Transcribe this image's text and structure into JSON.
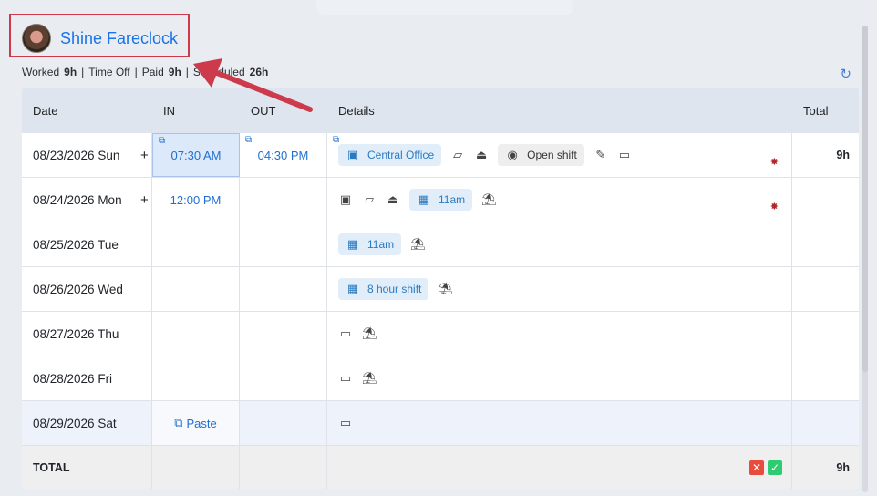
{
  "user": {
    "name": "Shine Fareclock"
  },
  "summary": {
    "worked_label": "Worked",
    "worked_value": "9h",
    "timeoff_label": "Time Off",
    "paid_label": "Paid",
    "paid_value": "9h",
    "scheduled_label": "Scheduled",
    "scheduled_value": "26h"
  },
  "columns": {
    "date": "Date",
    "in": "IN",
    "out": "OUT",
    "details": "Details",
    "total": "Total"
  },
  "rows": [
    {
      "date": "08/23/2026 Sun",
      "in": "07:30 AM",
      "out": "04:30 PM",
      "location": "Central Office",
      "open_shift": "Open shift",
      "total": "9h"
    },
    {
      "date": "08/24/2026 Mon",
      "in": "12:00 PM",
      "shift": "11am"
    },
    {
      "date": "08/25/2026 Tue",
      "shift": "11am"
    },
    {
      "date": "08/26/2026 Wed",
      "shift": "8 hour shift"
    },
    {
      "date": "08/27/2026 Thu"
    },
    {
      "date": "08/28/2026 Fri"
    },
    {
      "date": "08/29/2026 Sat",
      "paste": "Paste"
    }
  ],
  "total_row": {
    "label": "TOTAL",
    "total": "9h"
  },
  "colors": {
    "accent": "#1a73e8",
    "highlight": "#cc3a4c"
  }
}
